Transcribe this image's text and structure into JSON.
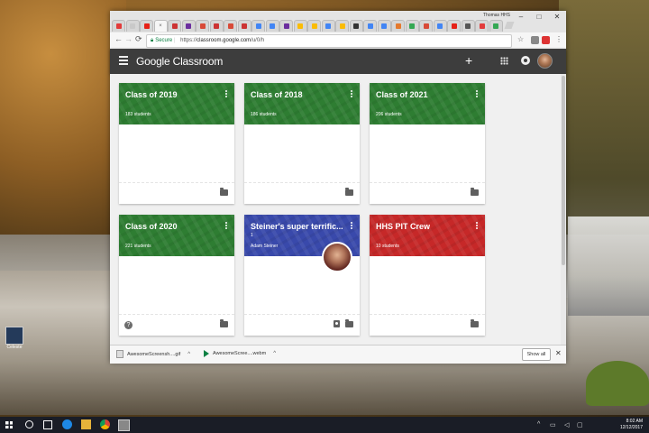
{
  "window": {
    "user_label": "Thomas HHS",
    "controls": [
      "–",
      "□",
      "✕"
    ]
  },
  "tabs": [
    {
      "color": "#e23b3b"
    },
    {
      "color": "#c9c9c9"
    },
    {
      "color": "#e62117"
    },
    {
      "color": "#aaaaaa",
      "active": true
    },
    {
      "color": "#cc3333"
    },
    {
      "color": "#6b2e9e"
    },
    {
      "color": "#d84a38"
    },
    {
      "color": "#cc3333"
    },
    {
      "color": "#d84a38"
    },
    {
      "color": "#cc3333"
    },
    {
      "color": "#4285f4"
    },
    {
      "color": "#4285f4"
    },
    {
      "color": "#6b2e9e"
    },
    {
      "color": "#fbbc05"
    },
    {
      "color": "#fbbc05"
    },
    {
      "color": "#4285f4"
    },
    {
      "color": "#fbbc05"
    },
    {
      "color": "#333333"
    },
    {
      "color": "#4285f4"
    },
    {
      "color": "#4285f4"
    },
    {
      "color": "#e47a2e"
    },
    {
      "color": "#34a853"
    },
    {
      "color": "#d84a38"
    },
    {
      "color": "#4285f4"
    },
    {
      "color": "#e62117"
    },
    {
      "color": "#555555"
    },
    {
      "color": "#e23b3b"
    },
    {
      "color": "#34a853"
    }
  ],
  "omnibox": {
    "secure": "Secure",
    "url_prefix": "https://",
    "host": "classroom.google.com",
    "path": "/u/0/h"
  },
  "app": {
    "brand": "Google Classroom",
    "add_symbol": "+"
  },
  "classes": [
    {
      "title": "Class of 2019",
      "subtitle": "183 students",
      "color": "#2e7d32"
    },
    {
      "title": "Class of 2018",
      "subtitle": "186 students",
      "color": "#2e7d32"
    },
    {
      "title": "Class of 2021",
      "subtitle": "206 students",
      "color": "#2e7d32"
    },
    {
      "title": "Class of 2020",
      "subtitle": "221 students",
      "color": "#2e7d32"
    },
    {
      "title": "Steiner's super terrific...",
      "number": "1",
      "subtitle": "Adam Steiner",
      "color": "#3949ab"
    },
    {
      "title": "HHS PIT Crew",
      "subtitle": "10 students",
      "color": "#c62828"
    }
  ],
  "help_symbol": "?",
  "downloads": {
    "items": [
      "AwesomeScreensh....gif",
      "AwesomeScree....webm"
    ],
    "show_all": "Show all"
  },
  "desktop_icon": {
    "label": "Celeste"
  },
  "taskbar": {
    "time": "8:02 AM",
    "date": "12/12/2017"
  }
}
